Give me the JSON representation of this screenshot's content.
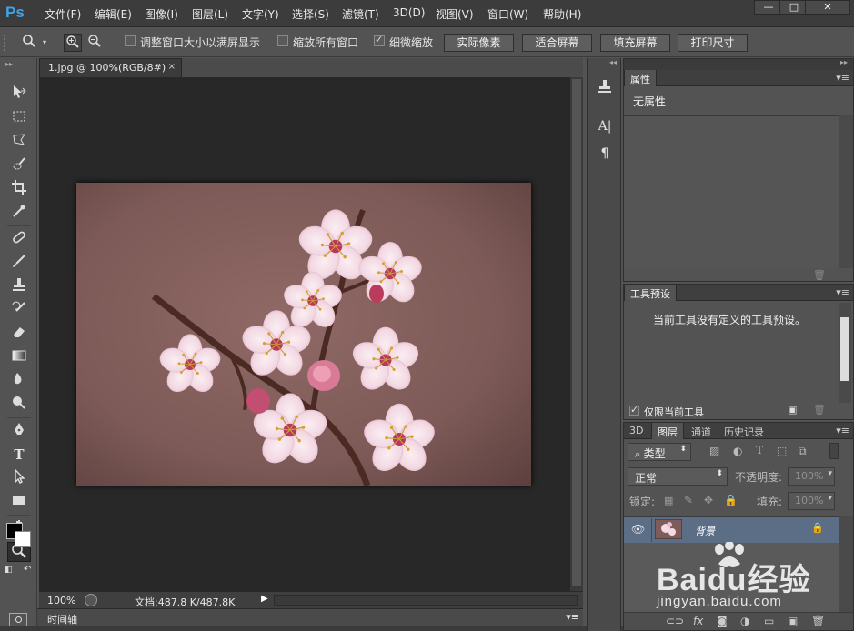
{
  "app": {
    "logo": "Ps"
  },
  "menu": [
    {
      "label": "文件(F)"
    },
    {
      "label": "编辑(E)"
    },
    {
      "label": "图像(I)"
    },
    {
      "label": "图层(L)"
    },
    {
      "label": "文字(Y)"
    },
    {
      "label": "选择(S)"
    },
    {
      "label": "滤镜(T)"
    },
    {
      "label": "3D(D)"
    },
    {
      "label": "视图(V)"
    },
    {
      "label": "窗口(W)"
    },
    {
      "label": "帮助(H)"
    }
  ],
  "window_controls": {
    "minimize": "—",
    "maximize": "□",
    "close": "✕"
  },
  "options": {
    "resize_window": {
      "label": "调整窗口大小以满屏显示",
      "checked": false
    },
    "zoom_all": {
      "label": "缩放所有窗口",
      "checked": false
    },
    "scrubby_zoom": {
      "label": "细微缩放",
      "checked": true
    },
    "actual_pixels": "实际像素",
    "fit_screen": "适合屏幕",
    "fill_screen": "填充屏幕",
    "print_size": "打印尺寸"
  },
  "document": {
    "tab_title": "1.jpg @ 100%(RGB/8#)",
    "tab_close": "×",
    "zoom": "100%",
    "doc_info": "文档:487.8 K/487.8K"
  },
  "timeline": {
    "label": "时间轴"
  },
  "properties_panel": {
    "tab": "属性",
    "message": "无属性"
  },
  "tool_presets_panel": {
    "tab": "工具预设",
    "message": "当前工具没有定义的工具预设。",
    "current_tool_only": {
      "label": "仅限当前工具",
      "checked": true
    }
  },
  "layers_panel": {
    "tabs": [
      {
        "label": "3D"
      },
      {
        "label": "图层"
      },
      {
        "label": "通道"
      },
      {
        "label": "历史记录"
      }
    ],
    "active_tab": "图层",
    "filter_kind": "类型",
    "blend_mode": "正常",
    "opacity_label": "不透明度:",
    "opacity_value": "100%",
    "lock_label": "锁定:",
    "fill_label": "填充:",
    "fill_value": "100%",
    "layers": [
      {
        "name": "背景",
        "visible": true,
        "locked": true
      }
    ]
  },
  "watermark": {
    "brand": "Baidu经验",
    "url": "jingyan.baidu.com"
  },
  "colors": {
    "accent": "#3fa3e6",
    "canvas_bg": "#282828",
    "ui_bg": "#535353",
    "layer_selected": "#5b6e86"
  }
}
